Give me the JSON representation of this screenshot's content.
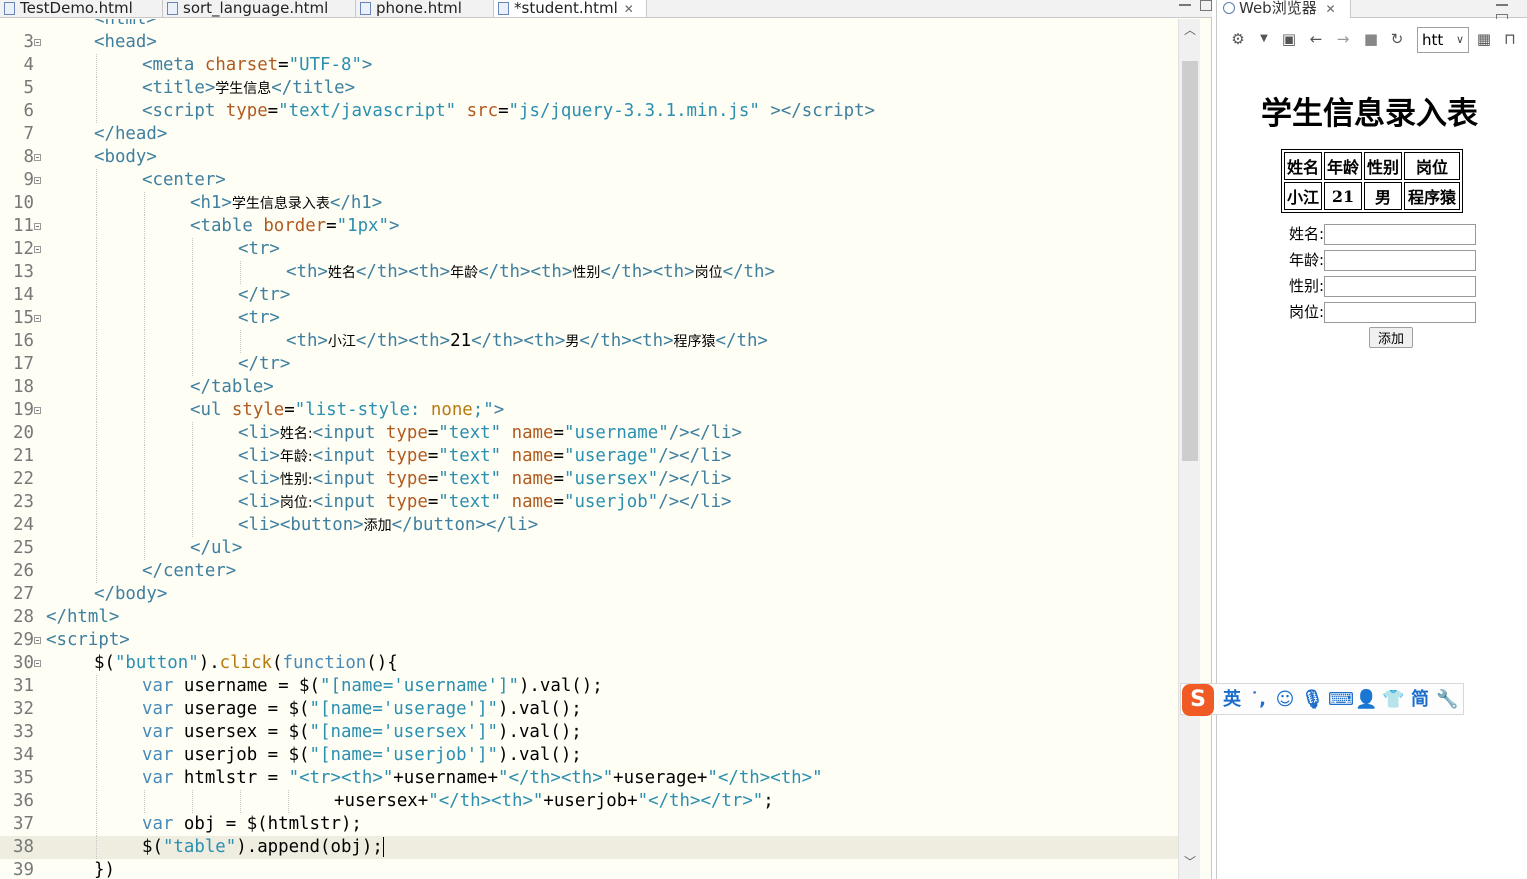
{
  "editor": {
    "tabs": [
      {
        "label": "TestDemo.html",
        "active": false
      },
      {
        "label": "sort_language.html",
        "active": false
      },
      {
        "label": "phone.html",
        "active": false
      },
      {
        "label": "*student.html",
        "active": true
      }
    ],
    "lines": [
      {
        "n": "",
        "fold": false,
        "indent": 1,
        "html": "<span class='t-tag'>&lt;html&gt;</span>"
      },
      {
        "n": "3",
        "fold": true,
        "indent": 1,
        "html": "<span class='t-tag'>&lt;head&gt;</span>"
      },
      {
        "n": "4",
        "fold": false,
        "indent": 2,
        "html": "<span class='t-tag'>&lt;meta</span> <span class='t-attr'>charset</span>=<span class='t-str'>\"UTF-8\"</span><span class='t-tag'>&gt;</span>"
      },
      {
        "n": "5",
        "fold": false,
        "indent": 2,
        "html": "<span class='t-tag'>&lt;title&gt;</span><span class='t-txt'>学生信息</span><span class='t-tag'>&lt;/title&gt;</span>"
      },
      {
        "n": "6",
        "fold": false,
        "indent": 2,
        "html": "<span class='t-tag'>&lt;script</span> <span class='t-attr'>type</span>=<span class='t-str'>\"text/javascript\"</span> <span class='t-attr'>src</span>=<span class='t-str'>\"js/jquery-3.3.1.min.js\"</span> <span class='t-tag'>&gt;&lt;/script&gt;</span>"
      },
      {
        "n": "7",
        "fold": false,
        "indent": 1,
        "html": "<span class='t-tag'>&lt;/head&gt;</span>"
      },
      {
        "n": "8",
        "fold": true,
        "indent": 1,
        "html": "<span class='t-tag'>&lt;body&gt;</span>"
      },
      {
        "n": "9",
        "fold": true,
        "indent": 2,
        "html": "<span class='t-tag'>&lt;center&gt;</span>"
      },
      {
        "n": "10",
        "fold": false,
        "indent": 3,
        "html": "<span class='t-tag'>&lt;h1&gt;</span><span class='t-txt'>学生信息录入表</span><span class='t-tag'>&lt;/h1&gt;</span>"
      },
      {
        "n": "11",
        "fold": true,
        "indent": 3,
        "html": "<span class='t-tag'>&lt;table</span> <span class='t-attr'>border</span>=<span class='t-str'>\"1px\"</span><span class='t-tag'>&gt;</span>"
      },
      {
        "n": "12",
        "fold": true,
        "indent": 4,
        "html": "<span class='t-tag'>&lt;tr&gt;</span>"
      },
      {
        "n": "13",
        "fold": false,
        "indent": 5,
        "html": "<span class='t-tag'>&lt;th&gt;</span><span class='t-txt'>姓名</span><span class='t-tag'>&lt;/th&gt;&lt;th&gt;</span><span class='t-txt'>年龄</span><span class='t-tag'>&lt;/th&gt;&lt;th&gt;</span><span class='t-txt'>性别</span><span class='t-tag'>&lt;/th&gt;&lt;th&gt;</span><span class='t-txt'>岗位</span><span class='t-tag'>&lt;/th&gt;</span>"
      },
      {
        "n": "14",
        "fold": false,
        "indent": 4,
        "html": "<span class='t-tag'>&lt;/tr&gt;</span>"
      },
      {
        "n": "15",
        "fold": true,
        "indent": 4,
        "html": "<span class='t-tag'>&lt;tr&gt;</span>"
      },
      {
        "n": "16",
        "fold": false,
        "indent": 5,
        "html": "<span class='t-tag'>&lt;th&gt;</span><span class='t-txt'>小江</span><span class='t-tag'>&lt;/th&gt;&lt;th&gt;</span>21<span class='t-tag'>&lt;/th&gt;&lt;th&gt;</span><span class='t-txt'>男</span><span class='t-tag'>&lt;/th&gt;&lt;th&gt;</span><span class='t-txt'>程序猿</span><span class='t-tag'>&lt;/th&gt;</span>"
      },
      {
        "n": "17",
        "fold": false,
        "indent": 4,
        "html": "<span class='t-tag'>&lt;/tr&gt;</span>"
      },
      {
        "n": "18",
        "fold": false,
        "indent": 3,
        "html": "<span class='t-tag'>&lt;/table&gt;</span>"
      },
      {
        "n": "19",
        "fold": true,
        "indent": 3,
        "html": "<span class='t-tag'>&lt;ul</span> <span class='t-attr'>style</span>=<span class='t-str'>\"list-style: </span><span class='t-fn'>none</span><span class='t-str'>;\"</span><span class='t-tag'>&gt;</span>"
      },
      {
        "n": "20",
        "fold": false,
        "indent": 4,
        "html": "<span class='t-tag'>&lt;li&gt;</span><span class='t-txt'>姓名:</span><span class='t-tag'>&lt;input</span> <span class='t-attr'>type</span>=<span class='t-str'>\"text\"</span> <span class='t-attr'>name</span>=<span class='t-str'>\"username\"</span><span class='t-tag'>/&gt;&lt;/li&gt;</span>"
      },
      {
        "n": "21",
        "fold": false,
        "indent": 4,
        "html": "<span class='t-tag'>&lt;li&gt;</span><span class='t-txt'>年龄:</span><span class='t-tag'>&lt;input</span> <span class='t-attr'>type</span>=<span class='t-str'>\"text\"</span> <span class='t-attr'>name</span>=<span class='t-str'>\"userage\"</span><span class='t-tag'>/&gt;&lt;/li&gt;</span>"
      },
      {
        "n": "22",
        "fold": false,
        "indent": 4,
        "html": "<span class='t-tag'>&lt;li&gt;</span><span class='t-txt'>性别:</span><span class='t-tag'>&lt;input</span> <span class='t-attr'>type</span>=<span class='t-str'>\"text\"</span> <span class='t-attr'>name</span>=<span class='t-str'>\"usersex\"</span><span class='t-tag'>/&gt;&lt;/li&gt;</span>"
      },
      {
        "n": "23",
        "fold": false,
        "indent": 4,
        "html": "<span class='t-tag'>&lt;li&gt;</span><span class='t-txt'>岗位:</span><span class='t-tag'>&lt;input</span> <span class='t-attr'>type</span>=<span class='t-str'>\"text\"</span> <span class='t-attr'>name</span>=<span class='t-str'>\"userjob\"</span><span class='t-tag'>/&gt;&lt;/li&gt;</span>"
      },
      {
        "n": "24",
        "fold": false,
        "indent": 4,
        "html": "<span class='t-tag'>&lt;li&gt;&lt;button&gt;</span><span class='t-txt'>添加</span><span class='t-tag'>&lt;/button&gt;&lt;/li&gt;</span>"
      },
      {
        "n": "25",
        "fold": false,
        "indent": 3,
        "html": "<span class='t-tag'>&lt;/ul&gt;</span>"
      },
      {
        "n": "26",
        "fold": false,
        "indent": 2,
        "html": "<span class='t-tag'>&lt;/center&gt;</span>"
      },
      {
        "n": "27",
        "fold": false,
        "indent": 1,
        "html": "<span class='t-tag'>&lt;/body&gt;</span>"
      },
      {
        "n": "28",
        "fold": false,
        "indent": 0,
        "html": "<span class='t-tag'>&lt;/html&gt;</span>"
      },
      {
        "n": "29",
        "fold": true,
        "indent": 0,
        "html": "<span class='t-tag'>&lt;script&gt;</span>"
      },
      {
        "n": "30",
        "fold": true,
        "indent": 1,
        "html": "$(<span class='t-str'>\"button\"</span>).<span class='t-fn'>click</span>(<span class='t-kw'>function</span>(){"
      },
      {
        "n": "31",
        "fold": false,
        "indent": 2,
        "html": "<span class='t-kw'>var</span> username = $(<span class='t-str'>\"[name='username']\"</span>).val();"
      },
      {
        "n": "32",
        "fold": false,
        "indent": 2,
        "html": "<span class='t-kw'>var</span> userage = $(<span class='t-str'>\"[name='userage']\"</span>).val();"
      },
      {
        "n": "33",
        "fold": false,
        "indent": 2,
        "html": "<span class='t-kw'>var</span> usersex = $(<span class='t-str'>\"[name='usersex']\"</span>).val();"
      },
      {
        "n": "34",
        "fold": false,
        "indent": 2,
        "html": "<span class='t-kw'>var</span> userjob = $(<span class='t-str'>\"[name='userjob']\"</span>).val();"
      },
      {
        "n": "35",
        "fold": false,
        "indent": 2,
        "html": "<span class='t-kw'>var</span> htmlstr = <span class='t-str'>\"&lt;tr&gt;&lt;th&gt;\"</span>+username+<span class='t-str'>\"&lt;/th&gt;&lt;th&gt;\"</span>+userage+<span class='t-str'>\"&lt;/th&gt;&lt;th&gt;\"</span>"
      },
      {
        "n": "36",
        "fold": false,
        "indent": 6,
        "html": "+usersex+<span class='t-str'>\"&lt;/th&gt;&lt;th&gt;\"</span>+userjob+<span class='t-str'>\"&lt;/th&gt;&lt;/tr&gt;\"</span>;"
      },
      {
        "n": "37",
        "fold": false,
        "indent": 2,
        "html": "<span class='t-kw'>var</span> obj = $(htmlstr);"
      },
      {
        "n": "38",
        "fold": false,
        "indent": 2,
        "current": true,
        "html": "$(<span class='t-str'>\"table\"</span>).append(obj);<span class='caret'></span>"
      },
      {
        "n": "39",
        "fold": false,
        "indent": 1,
        "html": "})"
      }
    ]
  },
  "browser": {
    "tab_label": "Web浏览器",
    "url_value": "htt",
    "page": {
      "title": "学生信息录入表",
      "table_header": [
        "姓名",
        "年龄",
        "性别",
        "岗位"
      ],
      "table_rows": [
        [
          "小江",
          "21",
          "男",
          "程序猿"
        ]
      ],
      "form_labels": [
        "姓名:",
        "年龄:",
        "性别:",
        "岗位:"
      ],
      "button_label": "添加"
    }
  },
  "ime": {
    "logo": "S",
    "mode_label": "英",
    "extra_label": "简"
  }
}
